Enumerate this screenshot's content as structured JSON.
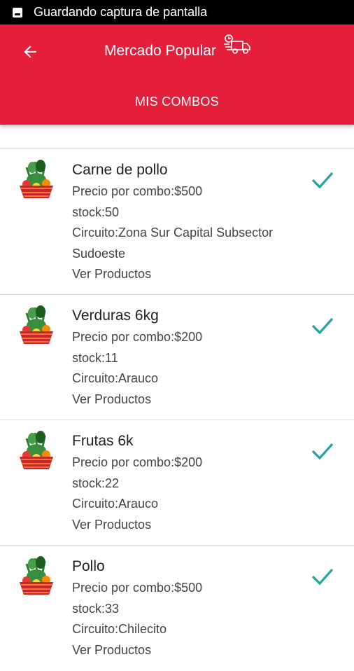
{
  "status_bar": {
    "text": "Guardando captura de pantalla"
  },
  "app_bar": {
    "title": "Mercado Popular",
    "tab": "MIS COMBOS"
  },
  "colors": {
    "primary": "#e51e3a",
    "check": "#26a69a"
  },
  "icons": {
    "back": "arrow-left-icon",
    "truck": "delivery-truck-icon",
    "check": "check-icon",
    "thumb": "grocery-basket-icon"
  },
  "combos": [
    {
      "title": "Carne de pollo",
      "price": "Precio por combo:$500",
      "stock": "stock:50",
      "circuit": "Circuito:Zona Sur Capital Subsector Sudoeste",
      "link": "Ver Productos"
    },
    {
      "title": "Verduras 6kg",
      "price": "Precio por combo:$200",
      "stock": "stock:11",
      "circuit": "Circuito:Arauco",
      "link": "Ver Productos"
    },
    {
      "title": "Frutas 6k",
      "price": "Precio por combo:$200",
      "stock": "stock:22",
      "circuit": "Circuito:Arauco",
      "link": "Ver Productos"
    },
    {
      "title": "Pollo",
      "price": "Precio por combo:$500",
      "stock": "stock:33",
      "circuit": "Circuito:Chilecito",
      "link": "Ver Productos"
    }
  ]
}
